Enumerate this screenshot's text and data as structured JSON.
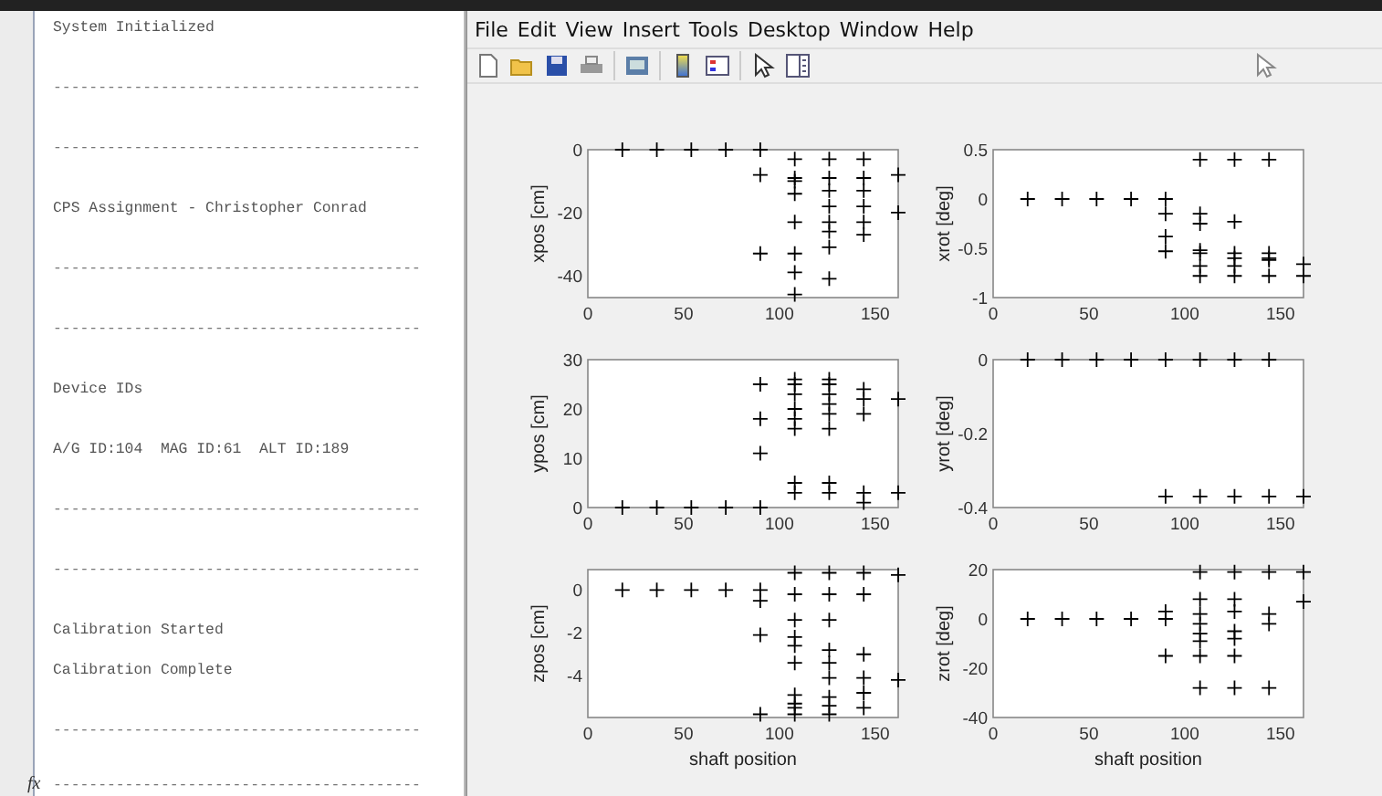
{
  "console": {
    "blocks": [
      {
        "lines": [
          {
            "kind": "text",
            "text": "System Initialized"
          }
        ]
      },
      {
        "lines": [
          {
            "kind": "rule",
            "text": "-----------------------------------------"
          }
        ]
      },
      {
        "lines": [
          {
            "kind": "rule",
            "text": "-----------------------------------------"
          }
        ]
      },
      {
        "lines": [
          {
            "kind": "text",
            "text": "CPS Assignment - Christopher Conrad"
          }
        ]
      },
      {
        "lines": [
          {
            "kind": "rule",
            "text": "-----------------------------------------"
          }
        ]
      },
      {
        "lines": [
          {
            "kind": "rule",
            "text": "-----------------------------------------"
          }
        ]
      },
      {
        "lines": [
          {
            "kind": "text",
            "text": "Device IDs"
          }
        ]
      },
      {
        "lines": [
          {
            "kind": "text",
            "text": "A/G ID:104  MAG ID:61  ALT ID:189"
          }
        ]
      },
      {
        "lines": [
          {
            "kind": "rule",
            "text": "-----------------------------------------"
          }
        ]
      },
      {
        "lines": [
          {
            "kind": "rule",
            "text": "-----------------------------------------"
          }
        ]
      },
      {
        "lines": [
          {
            "kind": "text",
            "text": "Calibration Started"
          },
          {
            "kind": "text",
            "text": "Calibration Complete"
          }
        ]
      },
      {
        "lines": [
          {
            "kind": "rule",
            "text": "-----------------------------------------"
          }
        ]
      }
    ],
    "prompt": {
      "symbol": "fx",
      "text": "-----------------------------------------"
    }
  },
  "figure": {
    "menu": [
      "File",
      "Edit",
      "View",
      "Insert",
      "Tools",
      "Desktop",
      "Window",
      "Help"
    ],
    "plots": [
      {
        "chart_data": {
          "type": "scatter",
          "ylabel": "xpos [cm]",
          "xlim": [
            0,
            162
          ],
          "ylim": [
            -47,
            0
          ],
          "xticks": [
            0,
            50,
            100,
            150
          ],
          "yticks": [
            -40,
            -20,
            0
          ],
          "x": [
            18,
            36,
            54,
            72,
            90,
            90,
            90,
            108,
            108,
            108,
            108,
            108,
            108,
            108,
            108,
            126,
            126,
            126,
            126,
            126,
            126,
            126,
            126,
            144,
            144,
            144,
            144,
            144,
            144,
            162,
            162
          ],
          "series": [
            {
              "color": "#000000",
              "values": [
                0,
                0,
                0,
                0,
                0,
                -8,
                -33,
                -3,
                -9,
                -10,
                -14,
                -23,
                -33,
                -39,
                -46,
                -3,
                -9,
                -13,
                -18,
                -23,
                -26,
                -31,
                -41,
                -3,
                -9,
                -13,
                -18,
                -23,
                -27,
                -8,
                -20
              ]
            }
          ]
        }
      },
      {
        "chart_data": {
          "type": "scatter",
          "ylabel": "xrot [deg]",
          "xlim": [
            0,
            162
          ],
          "ylim": [
            -1,
            0.5
          ],
          "xticks": [
            0,
            50,
            100,
            150
          ],
          "yticks": [
            -1,
            -0.5,
            0,
            0.5
          ],
          "x": [
            18,
            36,
            54,
            72,
            90,
            90,
            90,
            90,
            108,
            108,
            108,
            108,
            108,
            108,
            108,
            126,
            126,
            126,
            126,
            126,
            126,
            144,
            144,
            144,
            144,
            144,
            162,
            162
          ],
          "series": [
            {
              "color": "#000000",
              "values": [
                0,
                0,
                0,
                0,
                0,
                -0.15,
                -0.38,
                -0.53,
                0.4,
                -0.15,
                -0.25,
                -0.52,
                -0.55,
                -0.68,
                -0.78,
                0.4,
                -0.23,
                -0.55,
                -0.6,
                -0.68,
                -0.78,
                0.4,
                -0.55,
                -0.6,
                -0.62,
                -0.78,
                -0.66,
                -0.78
              ]
            }
          ]
        }
      },
      {
        "chart_data": {
          "type": "scatter",
          "ylabel": "ypos [cm]",
          "xlim": [
            0,
            162
          ],
          "ylim": [
            0,
            30
          ],
          "xticks": [
            0,
            50,
            100,
            150
          ],
          "yticks": [
            0,
            10,
            20,
            30
          ],
          "x": [
            18,
            36,
            54,
            72,
            90,
            90,
            90,
            90,
            108,
            108,
            108,
            108,
            108,
            108,
            108,
            108,
            126,
            126,
            126,
            126,
            126,
            126,
            126,
            126,
            144,
            144,
            144,
            144,
            144,
            162,
            162
          ],
          "series": [
            {
              "color": "#000000",
              "values": [
                0,
                0,
                0,
                0,
                0,
                11,
                18,
                25,
                3,
                5,
                16,
                18,
                20,
                23,
                25,
                26,
                3,
                5,
                16,
                19,
                21,
                23,
                25,
                26,
                1,
                3,
                19,
                22,
                24,
                3,
                22
              ]
            }
          ]
        }
      },
      {
        "chart_data": {
          "type": "scatter",
          "ylabel": "yrot [deg]",
          "xlim": [
            0,
            162
          ],
          "ylim": [
            -0.4,
            0
          ],
          "xticks": [
            0,
            50,
            100,
            150
          ],
          "yticks": [
            -0.4,
            -0.2,
            0
          ],
          "x": [
            18,
            36,
            54,
            72,
            90,
            108,
            126,
            144,
            90,
            108,
            126,
            144,
            162
          ],
          "series": [
            {
              "color": "#000000",
              "values": [
                0,
                0,
                0,
                0,
                0,
                0,
                0,
                0,
                -0.37,
                -0.37,
                -0.37,
                -0.37,
                -0.37
              ]
            }
          ]
        }
      },
      {
        "chart_data": {
          "type": "scatter",
          "xlabel": "shaft position",
          "ylabel": "zpos [cm]",
          "xlim": [
            0,
            162
          ],
          "ylim": [
            -5.95,
            0.95
          ],
          "xticks": [
            0,
            50,
            100,
            150
          ],
          "yticks": [
            -4,
            -2,
            0
          ],
          "x": [
            18,
            36,
            54,
            72,
            90,
            90,
            90,
            90,
            108,
            108,
            108,
            108,
            108,
            108,
            108,
            108,
            108,
            108,
            126,
            126,
            126,
            126,
            126,
            126,
            126,
            126,
            126,
            144,
            144,
            144,
            144,
            144,
            144,
            162,
            162
          ],
          "series": [
            {
              "color": "#000000",
              "values": [
                0,
                0,
                0,
                0,
                0,
                -0.5,
                -2.1,
                -5.8,
                0.8,
                -0.2,
                -1.4,
                -2.2,
                -2.6,
                -3.4,
                -4.9,
                -5.3,
                -5.5,
                -5.8,
                0.8,
                -0.2,
                -1.4,
                -2.8,
                -3.4,
                -4.1,
                -5.0,
                -5.4,
                -5.8,
                0.8,
                -0.2,
                -3.0,
                -4.1,
                -4.8,
                -5.5,
                0.7,
                -4.2
              ]
            }
          ]
        }
      },
      {
        "chart_data": {
          "type": "scatter",
          "xlabel": "shaft position",
          "ylabel": "zrot [deg]",
          "xlim": [
            0,
            162
          ],
          "ylim": [
            -40,
            20
          ],
          "xticks": [
            0,
            50,
            100,
            150
          ],
          "yticks": [
            -40,
            -20,
            0,
            20
          ],
          "x": [
            18,
            36,
            54,
            72,
            90,
            90,
            90,
            108,
            108,
            108,
            108,
            108,
            108,
            108,
            108,
            126,
            126,
            126,
            126,
            126,
            126,
            126,
            144,
            144,
            144,
            144,
            162,
            162
          ],
          "series": [
            {
              "color": "#000000",
              "values": [
                0,
                0,
                0,
                0,
                3,
                0,
                -15,
                19,
                8,
                2,
                -2,
                -6,
                -9,
                -15,
                -28,
                19,
                8,
                3,
                -5,
                -8,
                -15,
                -28,
                19,
                2,
                -2,
                -28,
                19,
                7
              ]
            }
          ]
        }
      }
    ]
  }
}
